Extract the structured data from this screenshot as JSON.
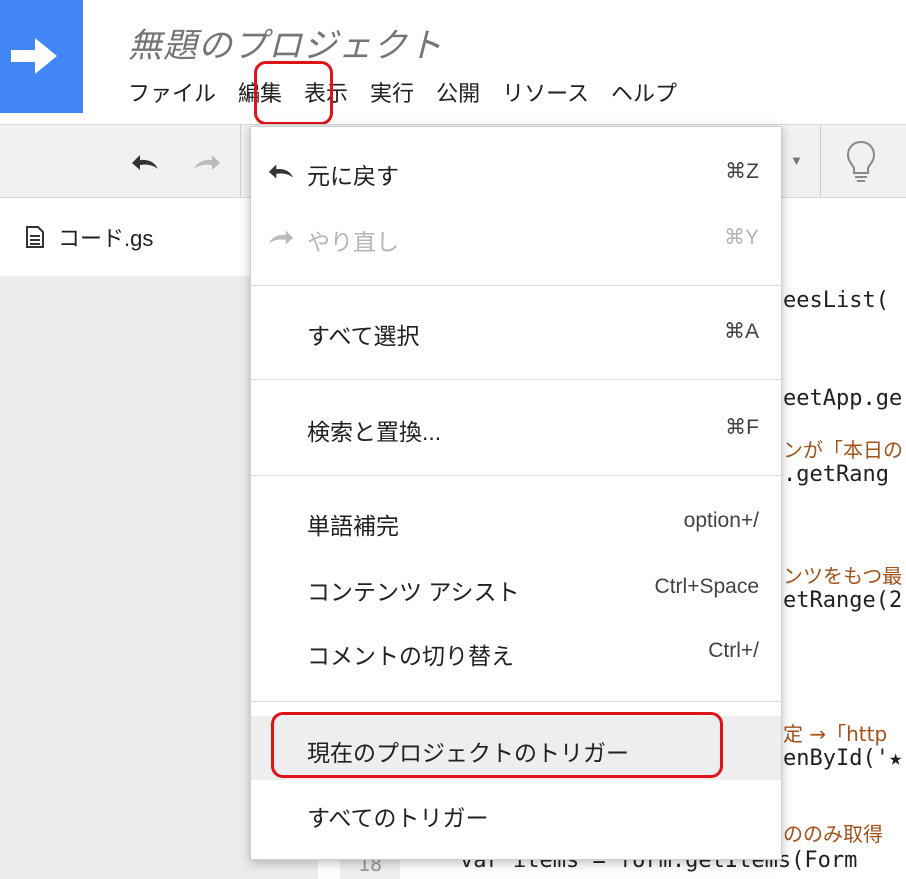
{
  "header": {
    "project_title": "無題のプロジェクト",
    "logo_icon": "arrow-right-icon",
    "brand_color": "#4285f4"
  },
  "menubar": {
    "items": [
      {
        "label": "ファイル"
      },
      {
        "label": "編集"
      },
      {
        "label": "表示"
      },
      {
        "label": "実行"
      },
      {
        "label": "公開"
      },
      {
        "label": "リソース"
      },
      {
        "label": "ヘルプ"
      }
    ],
    "active": "編集"
  },
  "toolbar": {
    "undo_icon": "undo-icon",
    "redo_icon": "redo-icon",
    "dropdown_icon": "caret-down-icon",
    "bulb_icon": "lightbulb-icon"
  },
  "sidebar": {
    "file_name": "コード.gs",
    "file_icon": "document-icon"
  },
  "editor": {
    "lines": [
      "eesList(",
      "eetApp.ge",
      "ンが「本日の",
      ".getRang",
      "ンツをもつ最",
      "etRange(2",
      "定 →「http",
      "enById('★",
      "ののみ取得",
      "var items = form.getItems(Form"
    ],
    "visible_line_number": "18"
  },
  "edit_menu": {
    "items": [
      {
        "label": "元に戻す",
        "shortcut": "⌘Z",
        "icon": "undo-icon",
        "disabled": false
      },
      {
        "label": "やり直し",
        "shortcut": "⌘Y",
        "icon": "redo-icon",
        "disabled": true
      },
      {
        "label": "すべて選択",
        "shortcut": "⌘A"
      },
      {
        "label": "検索と置換...",
        "shortcut": "⌘F"
      },
      {
        "label": "単語補完",
        "shortcut": "option+/"
      },
      {
        "label": "コンテンツ アシスト",
        "shortcut": "Ctrl+Space"
      },
      {
        "label": "コメントの切り替え",
        "shortcut": "Ctrl+/"
      },
      {
        "label": "現在のプロジェクトのトリガー",
        "hovered": true
      },
      {
        "label": "すべてのトリガー"
      }
    ]
  },
  "annotation_color": "#e0121a"
}
